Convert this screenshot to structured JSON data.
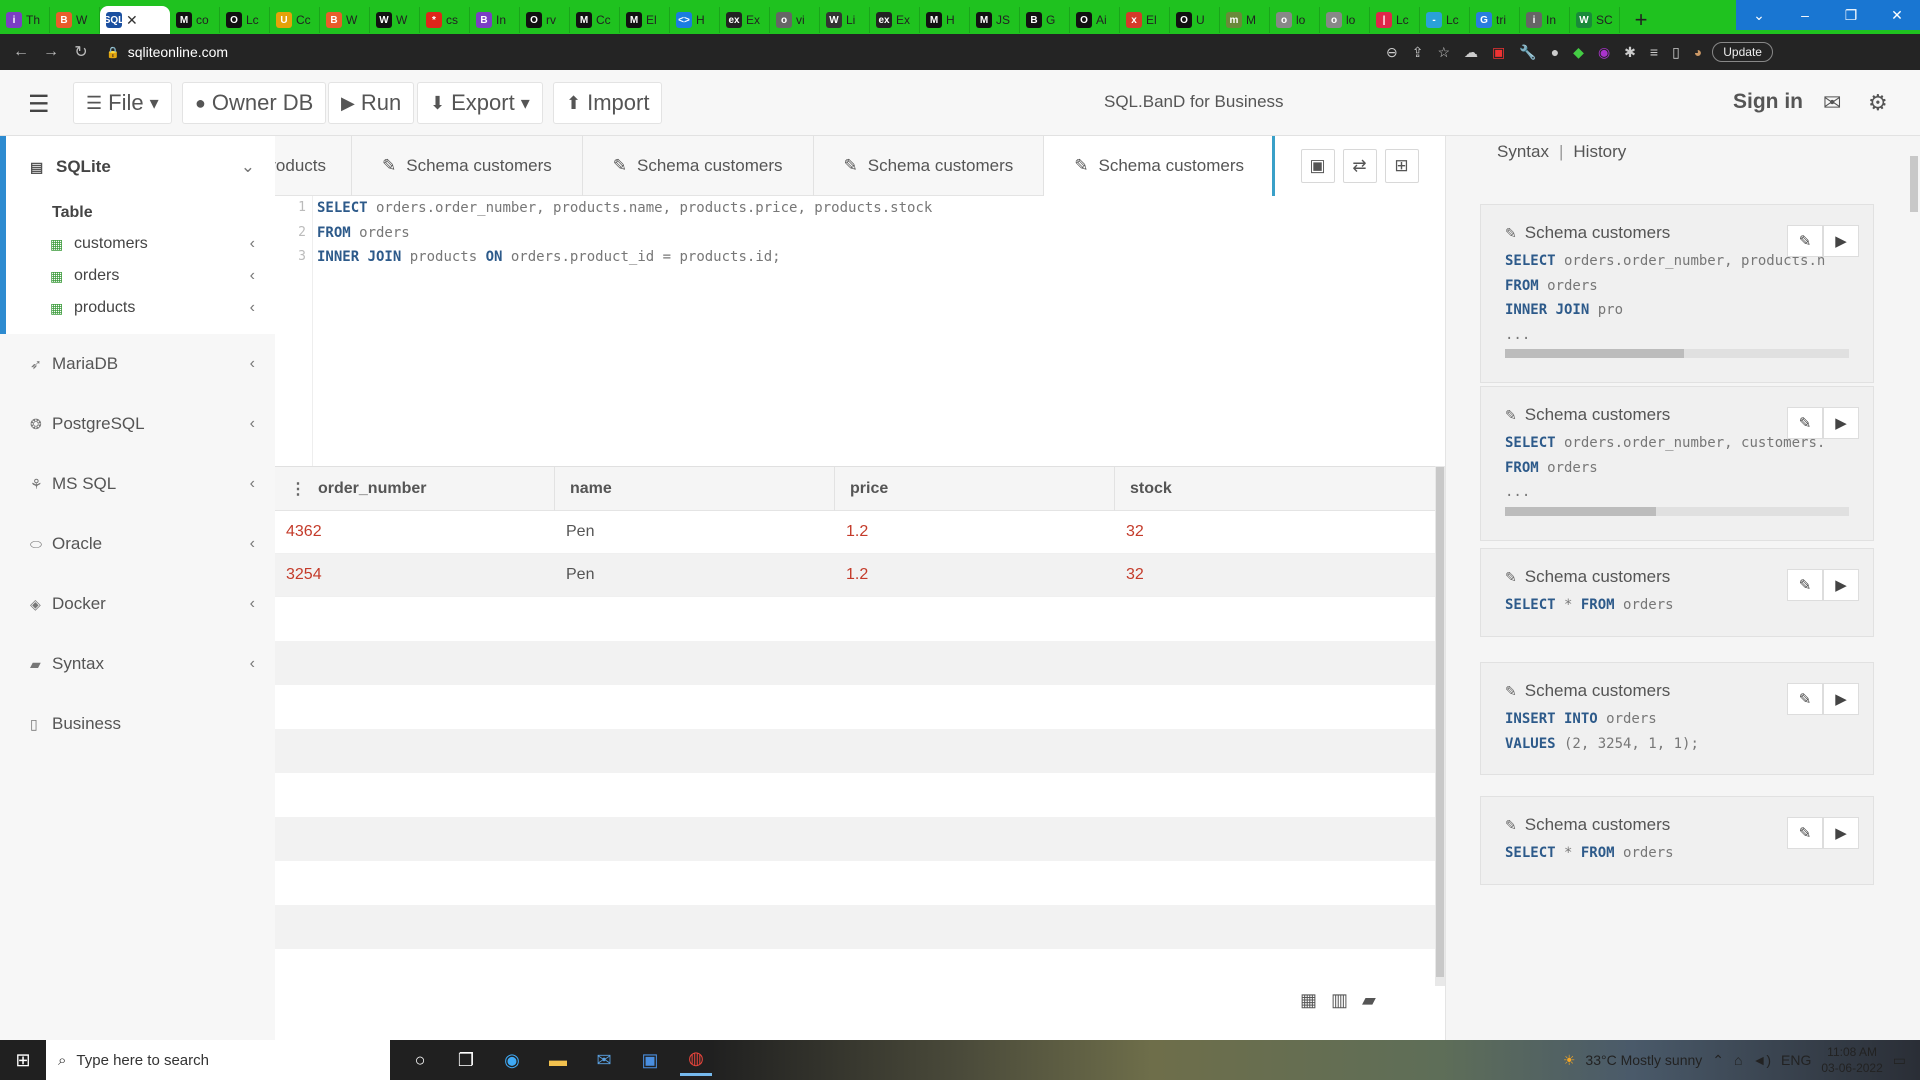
{
  "browser": {
    "tabs": [
      {
        "label": "Th",
        "color": "#7b3fc4",
        "glyph": "i"
      },
      {
        "label": "W",
        "color": "#e95d2b",
        "glyph": "B"
      },
      {
        "label": "",
        "color": "#1a4fa0",
        "glyph": "SQL",
        "active": true
      },
      {
        "label": "co",
        "color": "#111",
        "glyph": "M"
      },
      {
        "label": "Lc",
        "color": "#111",
        "glyph": "O"
      },
      {
        "label": "Cc",
        "color": "#e5a20a",
        "glyph": "U"
      },
      {
        "label": "W",
        "color": "#e95d2b",
        "glyph": "B"
      },
      {
        "label": "W",
        "color": "#111",
        "glyph": "W"
      },
      {
        "label": "cs",
        "color": "#e0261a",
        "glyph": "*"
      },
      {
        "label": "In",
        "color": "#7b3fc4",
        "glyph": "B"
      },
      {
        "label": "rv",
        "color": "#111",
        "glyph": "O"
      },
      {
        "label": "Cc",
        "color": "#111",
        "glyph": "M"
      },
      {
        "label": "El",
        "color": "#111",
        "glyph": "M"
      },
      {
        "label": "H",
        "color": "#1b7de0",
        "glyph": "<>"
      },
      {
        "label": "Ex",
        "color": "#222",
        "glyph": "ex"
      },
      {
        "label": "vi",
        "color": "#666",
        "glyph": "o"
      },
      {
        "label": "Li",
        "color": "#333",
        "glyph": "W"
      },
      {
        "label": "Ex",
        "color": "#222",
        "glyph": "ex"
      },
      {
        "label": "H",
        "color": "#111",
        "glyph": "M"
      },
      {
        "label": "JS",
        "color": "#111",
        "glyph": "M"
      },
      {
        "label": "G",
        "color": "#111",
        "glyph": "B"
      },
      {
        "label": "Ai",
        "color": "#111",
        "glyph": "O"
      },
      {
        "label": "El",
        "color": "#d63a2a",
        "glyph": "x"
      },
      {
        "label": "U",
        "color": "#111",
        "glyph": "O"
      },
      {
        "label": "M",
        "color": "#6a8a3a",
        "glyph": "m"
      },
      {
        "label": "lo",
        "color": "#888",
        "glyph": "o"
      },
      {
        "label": "lo",
        "color": "#888",
        "glyph": "o"
      },
      {
        "label": "Lc",
        "color": "#e0264a",
        "glyph": "|"
      },
      {
        "label": "Lc",
        "color": "#2aa1d9",
        "glyph": "-"
      },
      {
        "label": "tri",
        "color": "#2a7de0",
        "glyph": "G"
      },
      {
        "label": "In",
        "color": "#666",
        "glyph": "i"
      },
      {
        "label": "SC",
        "color": "#1a8a3a",
        "glyph": "W"
      }
    ],
    "new_tab": "+",
    "url": "sqliteonline.com",
    "update_label": "Update",
    "window_controls": [
      "⌄",
      "–",
      "❐",
      "✕"
    ]
  },
  "header": {
    "file": "File",
    "owner_db": "Owner DB",
    "run": "Run",
    "export": "Export",
    "import": "Import",
    "brand": "SQL.BanD for Business",
    "sign_in": "Sign in"
  },
  "sidebar": {
    "sqlite": "SQLite",
    "table_label": "Table",
    "tables": [
      "customers",
      "orders",
      "products"
    ],
    "groups": [
      "MariaDB",
      "PostgreSQL",
      "MS SQL",
      "Oracle",
      "Docker",
      "Syntax"
    ],
    "business": "Business"
  },
  "editor": {
    "tabs": [
      "ma products",
      "Schema customers",
      "Schema customers",
      "Schema customers",
      "Schema customers"
    ],
    "line_numbers": [
      "1",
      "2",
      "3"
    ],
    "lines": [
      {
        "kw": "SELECT",
        "rest": " orders.order_number, products.name, products.price, products.stock"
      },
      {
        "kw": "FROM",
        "rest": " orders"
      },
      {
        "kw": "INNER JOIN",
        "rest": " products ",
        "kw2": "ON",
        "rest2": " orders.product_id = products.id;"
      }
    ]
  },
  "results": {
    "columns": [
      "order_number",
      "name",
      "price",
      "stock"
    ],
    "rows": [
      [
        "4362",
        "Pen",
        "1.2",
        "32"
      ],
      [
        "3254",
        "Pen",
        "1.2",
        "32"
      ]
    ]
  },
  "history": {
    "tab_syntax": "Syntax",
    "sep": "|",
    "tab_history": "History",
    "cards": [
      {
        "title": "Schema customers",
        "lines": [
          [
            "SELECT",
            " orders.order_number, products.n"
          ],
          [
            "FROM",
            " orders"
          ],
          [
            "INNER JOIN",
            " pro"
          ],
          [
            "",
            "..."
          ]
        ],
        "bar": 0.52
      },
      {
        "title": "Schema customers",
        "lines": [
          [
            "SELECT",
            " orders.order_number, customers."
          ],
          [
            "FROM",
            " orders"
          ],
          [
            "",
            "..."
          ]
        ],
        "bar": 0.44
      },
      {
        "title": "Schema customers",
        "lines": [
          [
            "SELECT",
            " * ",
            "FROM",
            " orders"
          ]
        ]
      },
      {
        "title": "Schema customers",
        "lines": [
          [
            "INSERT INTO",
            " orders"
          ],
          [
            "VALUES",
            " (2, 3254, 1, 1);"
          ]
        ]
      },
      {
        "title": "Schema customers",
        "lines": [
          [
            "SELECT",
            " * ",
            "FROM",
            " orders"
          ]
        ]
      }
    ]
  },
  "taskbar": {
    "search_placeholder": "Type here to search",
    "weather": "33°C  Mostly sunny",
    "lang": "ENG",
    "time": "11:08 AM",
    "date": "03-06-2022"
  }
}
